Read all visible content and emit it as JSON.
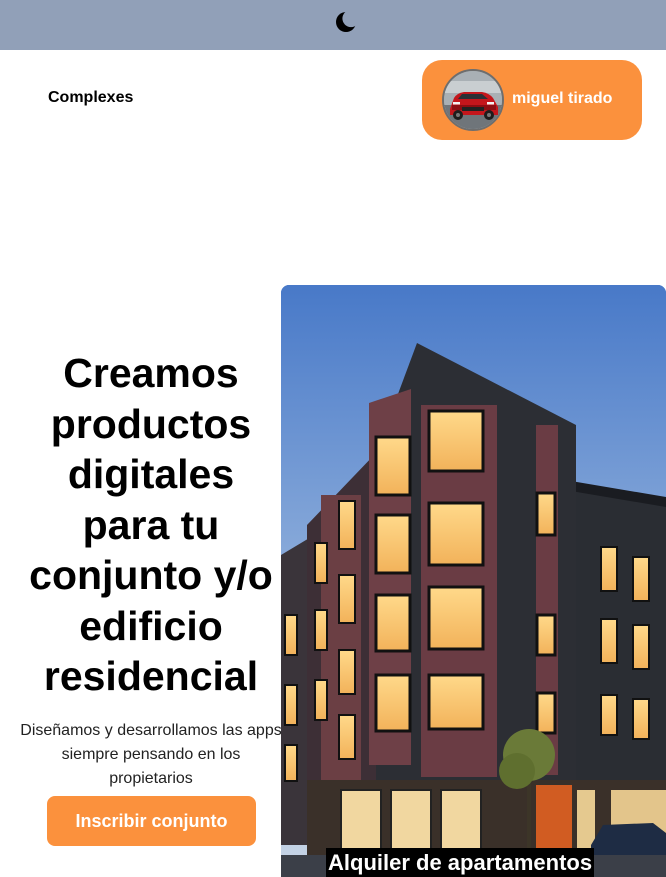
{
  "header": {
    "theme_icon": "moon-icon",
    "background": "#91a0b8"
  },
  "nav": {
    "brand": "Complexes",
    "user": {
      "name": "miguel tirado",
      "avatar_icon": "avatar-car-photo",
      "pill_color": "#fb913d"
    }
  },
  "hero": {
    "title": "Creamos productos digitales para tu conjunto y/o edificio residencial",
    "subtitle": "Diseñamos y desarrollamos las apps siempre pensando en los propietarios",
    "cta_label": "Inscribir conjunto",
    "accent": "#fb913d"
  },
  "showcase": {
    "caption": "Alquiler de apartamentos",
    "image_icon": "residential-building-photo"
  }
}
